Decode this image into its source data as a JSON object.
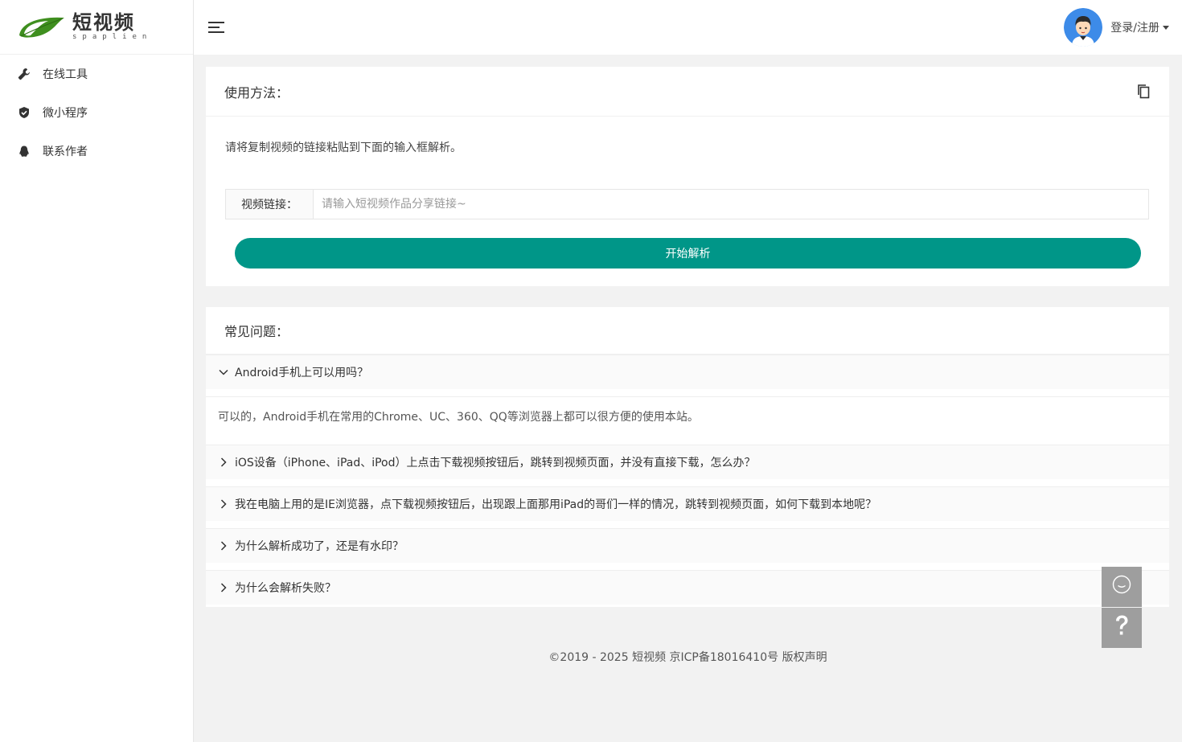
{
  "logo": {
    "main": "短视频",
    "sub": "spaplien",
    "leaf_color": "#4a9a2a"
  },
  "sidebar": {
    "items": [
      {
        "label": "在线工具",
        "icon": "wrench-icon"
      },
      {
        "label": "微小程序",
        "icon": "shield-check-icon"
      },
      {
        "label": "联系作者",
        "icon": "penguin-icon"
      }
    ]
  },
  "header": {
    "login_label": "登录/注册"
  },
  "usage_card": {
    "title": "使用方法：",
    "description": "请将复制视频的链接粘贴到下面的输入框解析。",
    "input_label": "视频链接：",
    "input_placeholder": "请输入短视频作品分享链接~",
    "input_value": "",
    "button_label": "开始解析"
  },
  "faq_card": {
    "title": "常见问题：",
    "items": [
      {
        "question": "Android手机上可以用吗？",
        "expanded": true,
        "answer": "可以的，Android手机在常用的Chrome、UC、360、QQ等浏览器上都可以很方便的使用本站。"
      },
      {
        "question": "iOS设备（iPhone、iPad、iPod）上点击下载视频按钮后，跳转到视频页面，并没有直接下载，怎么办？",
        "expanded": false
      },
      {
        "question": "我在电脑上用的是IE浏览器，点下载视频按钮后，出现跟上面那用iPad的哥们一样的情况，跳转到视频页面，如何下载到本地呢？",
        "expanded": false
      },
      {
        "question": "为什么解析成功了，还是有水印？",
        "expanded": false
      },
      {
        "question": "为什么会解析失败？",
        "expanded": false
      }
    ]
  },
  "footer": {
    "text": "©2019 - 2025 短视频 京ICP备18016410号 版权声明"
  },
  "colors": {
    "accent": "#009688",
    "float_button": "#9e9e9e"
  }
}
